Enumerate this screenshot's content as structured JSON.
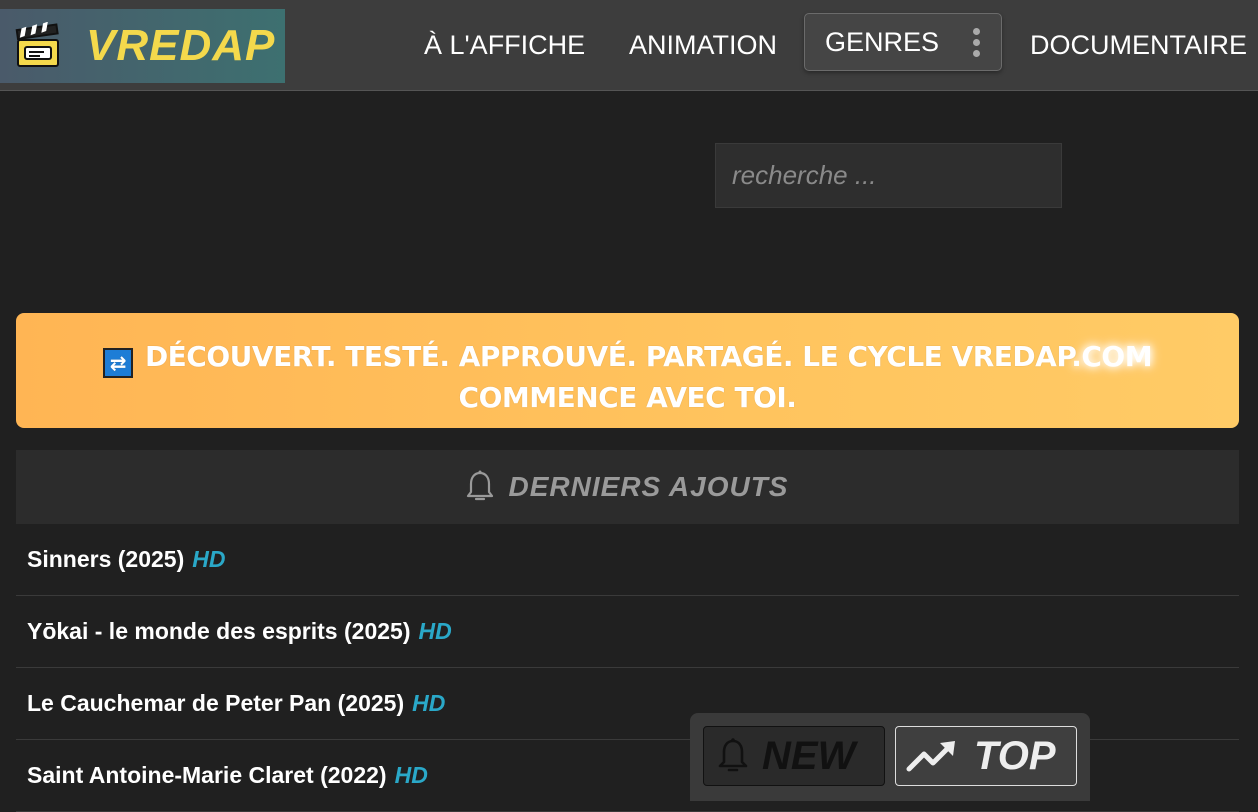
{
  "brand": {
    "name": "VREDAP",
    "logo_icon": "clapperboard-icon"
  },
  "nav": {
    "items": [
      "À L'AFFICHE",
      "ANIMATION",
      "GENRES",
      "DOCUMENTAIRE"
    ]
  },
  "search": {
    "placeholder": "recherche ...",
    "value": ""
  },
  "banner": {
    "icon": "cycle-icon",
    "line1_main": "DÉCOUVERT. TESTÉ. APPROUVÉ. PARTAGÉ. LE CYCLE VREDAP",
    "line1_glow": ".COM",
    "line2": "COMMENCE AVEC TOI."
  },
  "latest": {
    "icon": "bell-icon",
    "title": "DERNIERS AJOUTS",
    "items": [
      {
        "title": "Sinners (2025)",
        "badge": "HD"
      },
      {
        "title": "Yōkai - le monde des esprits (2025)",
        "badge": "HD"
      },
      {
        "title": "Le Cauchemar de Peter Pan (2025)",
        "badge": "HD"
      },
      {
        "title": "Saint Antoine-Marie Claret (2022)",
        "badge": "HD"
      }
    ]
  },
  "floatbar": {
    "new_label": "NEW",
    "top_label": "TOP"
  },
  "colors": {
    "accent_yellow": "#f4d94c",
    "banner_orange": "#ffb554",
    "hd_blue": "#2aa8c8"
  }
}
